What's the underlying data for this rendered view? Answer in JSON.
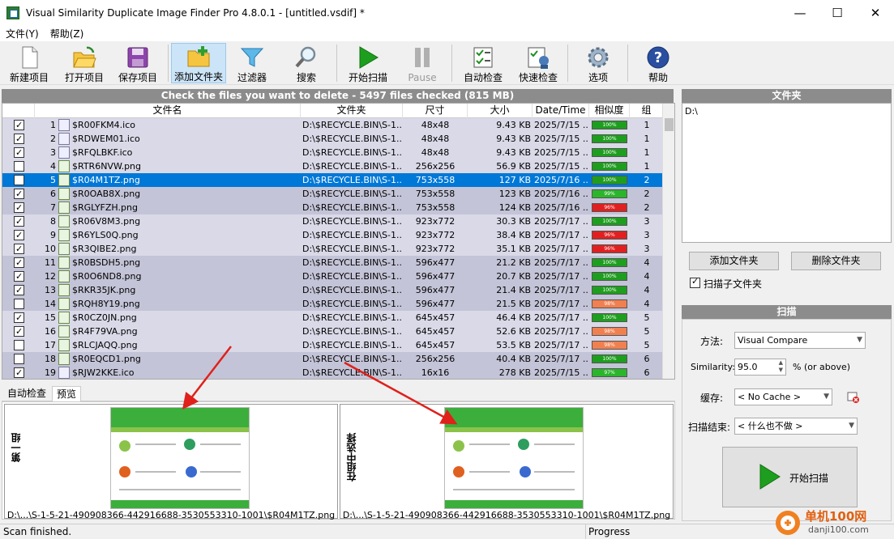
{
  "window": {
    "title": "Visual Similarity Duplicate Image Finder Pro 4.8.0.1 - [untitled.vsdif] *"
  },
  "menu": [
    "文件(Y)",
    "帮助(Z)"
  ],
  "toolbar": [
    {
      "label": "新建项目",
      "icon": "new-project-icon"
    },
    {
      "label": "打开项目",
      "icon": "open-folder-icon"
    },
    {
      "label": "保存项目",
      "icon": "save-disk-icon"
    },
    {
      "label": "添加文件夹",
      "icon": "add-folder-icon",
      "active": true
    },
    {
      "label": "过滤器",
      "icon": "filter-funnel-icon"
    },
    {
      "label": "搜索",
      "icon": "search-magnifier-icon"
    },
    {
      "label": "开始扫描",
      "icon": "play-icon"
    },
    {
      "label": "Pause",
      "icon": "pause-icon",
      "disabled": true
    },
    {
      "label": "自动检查",
      "icon": "auto-check-icon"
    },
    {
      "label": "快速检查",
      "icon": "quick-check-icon"
    },
    {
      "label": "选项",
      "icon": "gear-icon"
    },
    {
      "label": "帮助",
      "icon": "help-icon"
    }
  ],
  "list": {
    "header": "Check the files you want to delete - 5497 files checked (815 MB)",
    "columns": [
      "文件名",
      "文件夹",
      "尺寸",
      "大小",
      "Date/Time",
      "相似度",
      "组"
    ],
    "rows": [
      {
        "checked": true,
        "num": "1",
        "name": "$R00FKM4.ico",
        "folder": "D:\\$RECYCLE.BIN\\S-1...",
        "dim": "48x48",
        "size": "9.43 KB",
        "date": "2025/7/15 ...",
        "sim": "100%",
        "group": "1",
        "g": 0
      },
      {
        "checked": true,
        "num": "2",
        "name": "$RDWEM01.ico",
        "folder": "D:\\$RECYCLE.BIN\\S-1...",
        "dim": "48x48",
        "size": "9.43 KB",
        "date": "2025/7/15 ...",
        "sim": "100%",
        "group": "1",
        "g": 0
      },
      {
        "checked": true,
        "num": "3",
        "name": "$RFQLBKF.ico",
        "folder": "D:\\$RECYCLE.BIN\\S-1...",
        "dim": "48x48",
        "size": "9.43 KB",
        "date": "2025/7/15 ...",
        "sim": "100%",
        "group": "1",
        "g": 0
      },
      {
        "checked": false,
        "num": "4",
        "name": "$RTR6NVW.png",
        "folder": "D:\\$RECYCLE.BIN\\S-1...",
        "dim": "256x256",
        "size": "56.9 KB",
        "date": "2025/7/15 ...",
        "sim": "100%",
        "group": "1",
        "g": 0
      },
      {
        "checked": false,
        "num": "5",
        "name": "$R04M1TZ.png",
        "folder": "D:\\$RECYCLE.BIN\\S-1...",
        "dim": "753x558",
        "size": "127 KB",
        "date": "2025/7/16 ...",
        "sim": "100%",
        "group": "2",
        "g": 1,
        "selected": true
      },
      {
        "checked": true,
        "num": "6",
        "name": "$R0OAB8X.png",
        "folder": "D:\\$RECYCLE.BIN\\S-1...",
        "dim": "753x558",
        "size": "123 KB",
        "date": "2025/7/16 ...",
        "sim": "99%",
        "group": "2",
        "g": 1
      },
      {
        "checked": true,
        "num": "7",
        "name": "$RGLYFZH.png",
        "folder": "D:\\$RECYCLE.BIN\\S-1...",
        "dim": "753x558",
        "size": "124 KB",
        "date": "2025/7/16 ...",
        "sim": "96%",
        "group": "2",
        "g": 1
      },
      {
        "checked": true,
        "num": "8",
        "name": "$R06V8M3.png",
        "folder": "D:\\$RECYCLE.BIN\\S-1...",
        "dim": "923x772",
        "size": "30.3 KB",
        "date": "2025/7/17 ...",
        "sim": "100%",
        "group": "3",
        "g": 0
      },
      {
        "checked": true,
        "num": "9",
        "name": "$R6YLS0Q.png",
        "folder": "D:\\$RECYCLE.BIN\\S-1...",
        "dim": "923x772",
        "size": "38.4 KB",
        "date": "2025/7/17 ...",
        "sim": "96%",
        "group": "3",
        "g": 0
      },
      {
        "checked": true,
        "num": "10",
        "name": "$R3QIBE2.png",
        "folder": "D:\\$RECYCLE.BIN\\S-1...",
        "dim": "923x772",
        "size": "35.1 KB",
        "date": "2025/7/17 ...",
        "sim": "96%",
        "group": "3",
        "g": 0
      },
      {
        "checked": true,
        "num": "11",
        "name": "$R0BSDH5.png",
        "folder": "D:\\$RECYCLE.BIN\\S-1...",
        "dim": "596x477",
        "size": "21.2 KB",
        "date": "2025/7/17 ...",
        "sim": "100%",
        "group": "4",
        "g": 1
      },
      {
        "checked": true,
        "num": "12",
        "name": "$R0O6ND8.png",
        "folder": "D:\\$RECYCLE.BIN\\S-1...",
        "dim": "596x477",
        "size": "20.7 KB",
        "date": "2025/7/17 ...",
        "sim": "100%",
        "group": "4",
        "g": 1
      },
      {
        "checked": true,
        "num": "13",
        "name": "$RKR35JK.png",
        "folder": "D:\\$RECYCLE.BIN\\S-1...",
        "dim": "596x477",
        "size": "21.4 KB",
        "date": "2025/7/17 ...",
        "sim": "100%",
        "group": "4",
        "g": 1
      },
      {
        "checked": false,
        "num": "14",
        "name": "$RQH8Y19.png",
        "folder": "D:\\$RECYCLE.BIN\\S-1...",
        "dim": "596x477",
        "size": "21.5 KB",
        "date": "2025/7/17 ...",
        "sim": "98%",
        "group": "4",
        "g": 1
      },
      {
        "checked": true,
        "num": "15",
        "name": "$R0CZ0JN.png",
        "folder": "D:\\$RECYCLE.BIN\\S-1...",
        "dim": "645x457",
        "size": "46.4 KB",
        "date": "2025/7/17 ...",
        "sim": "100%",
        "group": "5",
        "g": 0
      },
      {
        "checked": true,
        "num": "16",
        "name": "$R4F79VA.png",
        "folder": "D:\\$RECYCLE.BIN\\S-1...",
        "dim": "645x457",
        "size": "52.6 KB",
        "date": "2025/7/17 ...",
        "sim": "98%",
        "group": "5",
        "g": 0
      },
      {
        "checked": false,
        "num": "17",
        "name": "$RLCJAQQ.png",
        "folder": "D:\\$RECYCLE.BIN\\S-1...",
        "dim": "645x457",
        "size": "53.5 KB",
        "date": "2025/7/17 ...",
        "sim": "98%",
        "group": "5",
        "g": 0
      },
      {
        "checked": false,
        "num": "18",
        "name": "$R0EQCD1.png",
        "folder": "D:\\$RECYCLE.BIN\\S-1...",
        "dim": "256x256",
        "size": "40.4 KB",
        "date": "2025/7/17 ...",
        "sim": "100%",
        "group": "6",
        "g": 1
      },
      {
        "checked": true,
        "num": "19",
        "name": "$RJW2KKE.ico",
        "folder": "D:\\$RECYCLE.BIN\\S-1...",
        "dim": "16x16",
        "size": "278 KB",
        "date": "2025/7/15 ...",
        "sim": "97%",
        "group": "6",
        "g": 1
      }
    ]
  },
  "tabs": [
    "自动检查",
    "预览"
  ],
  "preview": {
    "left_label": "第一组",
    "right_label": "在组中选择",
    "left_path": "D:\\...\\S-1-5-21-490908366-442916688-3530553310-1001\\$R04M1TZ.png",
    "right_path": "D:\\...\\S-1-5-21-490908366-442916688-3530553310-1001\\$R04M1TZ.png"
  },
  "folders": {
    "header": "文件夹",
    "items": [
      "D:\\"
    ],
    "add_button": "添加文件夹",
    "delete_button": "删除文件夹",
    "subfolders_label": "扫描子文件夹",
    "subfolders_checked": true
  },
  "scan": {
    "header": "扫描",
    "method_label": "方法:",
    "method_value": "Visual Compare",
    "similarity_label": "Similarity:",
    "similarity_value": "95.0",
    "similarity_suffix": "% (or above)",
    "cache_label": "缓存:",
    "cache_value": "< No Cache >",
    "end_label": "扫描结束:",
    "end_value": "< 什么也不做 >",
    "start_button": "开始扫描"
  },
  "status": {
    "left": "Scan finished.",
    "right": "Progress"
  },
  "watermark": {
    "text": "单机100网",
    "url": "danji100.com"
  },
  "colors": {
    "sim_green": "#1e9e1e",
    "sim_red": "#e02020",
    "sim_orange": "#f08050",
    "sim_lightgreen": "#2bb52b",
    "selected": "#0078d7"
  }
}
